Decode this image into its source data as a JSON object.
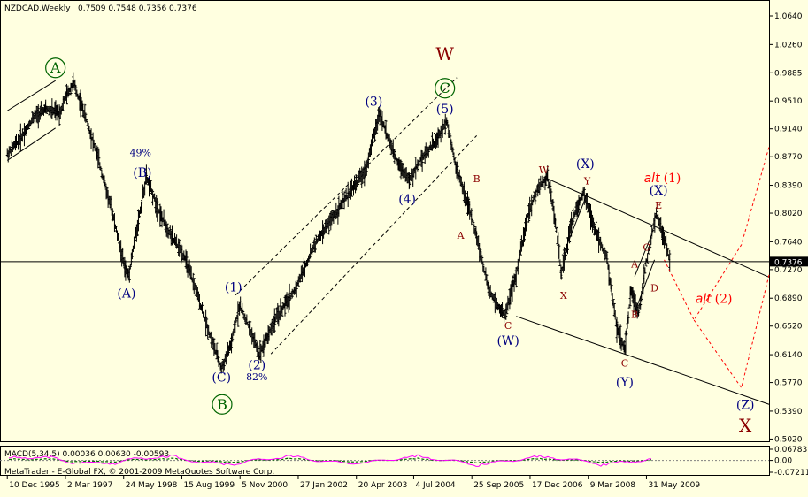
{
  "chart_data": {
    "type": "ohlc",
    "header": {
      "symbol_period": "NZDCAD,Weekly",
      "ohlc": "0.7509 0.7548 0.7356 0.7376"
    },
    "price_axis": {
      "min": 0.5025,
      "max": 1.064,
      "ticks": [
        "1.0640",
        "1.0260",
        "0.9885",
        "0.9510",
        "0.9140",
        "0.8770",
        "0.8390",
        "0.8020",
        "0.7640",
        "0.7270",
        "0.6890",
        "0.6520",
        "0.6140",
        "0.5770",
        "0.5390",
        "0.5020"
      ],
      "current_price": "0.7376",
      "current_value": 0.7376
    },
    "time_axis": {
      "ticks": [
        "10 Dec 1995",
        "2 Mar 1997",
        "24 May 1998",
        "15 Aug 1999",
        "5 Nov 2000",
        "27 Jan 2002",
        "20 Apr 2003",
        "4 Jul 2004",
        "25 Sep 2005",
        "17 Dec 2006",
        "9 Mar 2008",
        "31 May 2009"
      ]
    },
    "price_path": [
      {
        "date": "1995-12-10",
        "price": 0.88
      },
      {
        "date": "1996-03-15",
        "price": 0.9
      },
      {
        "date": "1996-07-01",
        "price": 0.93
      },
      {
        "date": "1996-10-01",
        "price": 0.94
      },
      {
        "date": "1997-01-15",
        "price": 0.935
      },
      {
        "date": "1997-03-15",
        "price": 0.96
      },
      {
        "date": "1997-05-01",
        "price": 0.975
      },
      {
        "date": "1997-07-15",
        "price": 0.94
      },
      {
        "date": "1997-11-01",
        "price": 0.88
      },
      {
        "date": "1998-03-01",
        "price": 0.8
      },
      {
        "date": "1998-06-01",
        "price": 0.73
      },
      {
        "date": "1998-07-01",
        "price": 0.72
      },
      {
        "date": "1998-09-01",
        "price": 0.78
      },
      {
        "date": "1998-11-15",
        "price": 0.85
      },
      {
        "date": "1999-03-01",
        "price": 0.8
      },
      {
        "date": "1999-06-01",
        "price": 0.77
      },
      {
        "date": "1999-09-01",
        "price": 0.745
      },
      {
        "date": "1999-12-01",
        "price": 0.7
      },
      {
        "date": "2000-03-01",
        "price": 0.65
      },
      {
        "date": "2000-06-15",
        "price": 0.595
      },
      {
        "date": "2000-09-01",
        "price": 0.63
      },
      {
        "date": "2000-11-01",
        "price": 0.68
      },
      {
        "date": "2001-01-15",
        "price": 0.65
      },
      {
        "date": "2001-04-01",
        "price": 0.615
      },
      {
        "date": "2001-08-01",
        "price": 0.66
      },
      {
        "date": "2002-01-01",
        "price": 0.7
      },
      {
        "date": "2002-06-01",
        "price": 0.76
      },
      {
        "date": "2002-11-01",
        "price": 0.8
      },
      {
        "date": "2003-03-01",
        "price": 0.83
      },
      {
        "date": "2003-07-01",
        "price": 0.86
      },
      {
        "date": "2003-10-15",
        "price": 0.935
      },
      {
        "date": "2004-02-01",
        "price": 0.88
      },
      {
        "date": "2004-06-01",
        "price": 0.845
      },
      {
        "date": "2004-09-01",
        "price": 0.875
      },
      {
        "date": "2005-01-01",
        "price": 0.9
      },
      {
        "date": "2005-03-15",
        "price": 0.925
      },
      {
        "date": "2005-06-01",
        "price": 0.86
      },
      {
        "date": "2005-09-01",
        "price": 0.81
      },
      {
        "date": "2005-11-01",
        "price": 0.77
      },
      {
        "date": "2006-02-01",
        "price": 0.7
      },
      {
        "date": "2006-06-01",
        "price": 0.665
      },
      {
        "date": "2006-09-01",
        "price": 0.72
      },
      {
        "date": "2006-12-01",
        "price": 0.8
      },
      {
        "date": "2007-02-15",
        "price": 0.835
      },
      {
        "date": "2007-05-01",
        "price": 0.85
      },
      {
        "date": "2007-07-01",
        "price": 0.79
      },
      {
        "date": "2007-08-15",
        "price": 0.72
      },
      {
        "date": "2007-11-01",
        "price": 0.79
      },
      {
        "date": "2008-02-01",
        "price": 0.83
      },
      {
        "date": "2008-05-01",
        "price": 0.78
      },
      {
        "date": "2008-08-01",
        "price": 0.74
      },
      {
        "date": "2008-10-15",
        "price": 0.65
      },
      {
        "date": "2008-12-15",
        "price": 0.62
      },
      {
        "date": "2009-02-01",
        "price": 0.7
      },
      {
        "date": "2009-04-01",
        "price": 0.67
      },
      {
        "date": "2009-06-01",
        "price": 0.74
      },
      {
        "date": "2009-08-15",
        "price": 0.8
      },
      {
        "date": "2009-10-01",
        "price": 0.775
      },
      {
        "date": "2009-12-01",
        "price": 0.738
      }
    ],
    "wave_labels": [
      {
        "text": "A",
        "style": "green-circle",
        "date": "1996-12-15",
        "price": 0.995
      },
      {
        "text": "49%",
        "style": "navy-small",
        "date": "1998-10-01",
        "price": 0.878
      },
      {
        "text": "(B)",
        "style": "navy",
        "date": "1998-10-15",
        "price": 0.85
      },
      {
        "text": "(A)",
        "style": "navy",
        "date": "1998-06-15",
        "price": 0.69
      },
      {
        "text": "(C)",
        "style": "navy",
        "date": "2000-06-15",
        "price": 0.578
      },
      {
        "text": "B",
        "style": "green-circle",
        "date": "2000-06-20",
        "price": 0.548
      },
      {
        "text": "(1)",
        "style": "navy",
        "date": "2000-09-15",
        "price": 0.698
      },
      {
        "text": "(2)",
        "style": "navy",
        "date": "2001-03-15",
        "price": 0.595
      },
      {
        "text": "82%",
        "style": "navy-small",
        "date": "2001-03-15",
        "price": 0.58
      },
      {
        "text": "(3)",
        "style": "navy",
        "date": "2003-09-01",
        "price": 0.945
      },
      {
        "text": "(4)",
        "style": "navy",
        "date": "2004-05-15",
        "price": 0.815
      },
      {
        "text": "(5)",
        "style": "navy",
        "date": "2005-03-01",
        "price": 0.935
      },
      {
        "text": "C",
        "style": "green-circle",
        "date": "2005-03-01",
        "price": 0.968
      },
      {
        "text": "W",
        "style": "red-large",
        "date": "2005-03-01",
        "price": 1.005
      },
      {
        "text": "B",
        "style": "red",
        "date": "2005-11-01",
        "price": 0.843
      },
      {
        "text": "A",
        "style": "red",
        "date": "2005-07-01",
        "price": 0.768
      },
      {
        "text": "C",
        "style": "red",
        "date": "2006-07-01",
        "price": 0.648
      },
      {
        "text": "(W)",
        "style": "navy",
        "date": "2006-07-01",
        "price": 0.627
      },
      {
        "text": "W",
        "style": "red",
        "date": "2007-04-01",
        "price": 0.855
      },
      {
        "text": "X",
        "style": "red",
        "date": "2007-09-01",
        "price": 0.688
      },
      {
        "text": "(X)",
        "style": "navy",
        "date": "2008-02-15",
        "price": 0.862
      },
      {
        "text": "Y",
        "style": "red",
        "date": "2008-03-01",
        "price": 0.84
      },
      {
        "text": "C",
        "style": "red",
        "date": "2008-12-15",
        "price": 0.598
      },
      {
        "text": "(Y)",
        "style": "navy",
        "date": "2008-12-15",
        "price": 0.572
      },
      {
        "text": "B",
        "style": "red",
        "date": "2009-03-01",
        "price": 0.663
      },
      {
        "text": "A",
        "style": "red",
        "date": "2009-03-01",
        "price": 0.73
      },
      {
        "text": "C",
        "style": "red",
        "date": "2009-06-01",
        "price": 0.752
      },
      {
        "text": "D",
        "style": "red",
        "date": "2009-08-01",
        "price": 0.698
      },
      {
        "text": "E",
        "style": "red",
        "date": "2009-09-01",
        "price": 0.808
      },
      {
        "text": "(X)",
        "style": "navy",
        "date": "2009-09-01",
        "price": 0.827
      },
      {
        "text": "(2)",
        "style": "red-alt",
        "alt": "alt",
        "date": "2010-11-01",
        "price": 0.683
      },
      {
        "text": "(Z)",
        "style": "navy",
        "date": "2011-07-01",
        "price": 0.542
      },
      {
        "text": "X",
        "style": "red-large",
        "date": "2011-07-01",
        "price": 0.512
      }
    ],
    "alt_one_label": {
      "alt": "alt",
      "text": "(1)",
      "date": "2009-08-15",
      "price": 0.843
    },
    "channels": [
      {
        "style": "solid",
        "points": [
          {
            "date": "1995-12-10",
            "price": 0.938
          },
          {
            "date": "1996-12-15",
            "price": 0.978
          }
        ]
      },
      {
        "style": "solid",
        "points": [
          {
            "date": "1995-12-10",
            "price": 0.872
          },
          {
            "date": "1996-12-15",
            "price": 0.915
          }
        ]
      },
      {
        "style": "dashed",
        "points": [
          {
            "date": "2000-10-01",
            "price": 0.693
          },
          {
            "date": "2005-06-01",
            "price": 0.982
          }
        ]
      },
      {
        "style": "dashed",
        "points": [
          {
            "date": "2001-07-01",
            "price": 0.615
          },
          {
            "date": "2005-11-01",
            "price": 0.905
          }
        ]
      },
      {
        "style": "solid",
        "points": [
          {
            "date": "2007-04-01",
            "price": 0.85
          },
          {
            "date": "2011-12-31",
            "price": 0.717
          }
        ]
      },
      {
        "style": "solid",
        "points": [
          {
            "date": "2006-09-01",
            "price": 0.665
          },
          {
            "date": "2011-12-31",
            "price": 0.548
          }
        ]
      },
      {
        "style": "solid",
        "points": [
          {
            "date": "2007-09-01",
            "price": 0.748
          },
          {
            "date": "2008-03-01",
            "price": 0.828
          }
        ]
      },
      {
        "style": "solid",
        "points": [
          {
            "date": "2009-03-01",
            "price": 0.67
          },
          {
            "date": "2009-08-01",
            "price": 0.74
          }
        ]
      },
      {
        "style": "solid",
        "points": [
          {
            "date": "2009-03-01",
            "price": 0.718
          },
          {
            "date": "2009-07-15",
            "price": 0.775
          }
        ]
      }
    ],
    "projections": [
      {
        "style": "red-dashed",
        "points": [
          {
            "date": "2009-10-15",
            "price": 0.74
          },
          {
            "date": "2010-06-01",
            "price": 0.66
          },
          {
            "date": "2011-06-01",
            "price": 0.76
          },
          {
            "date": "2011-12-31",
            "price": 0.89
          }
        ]
      },
      {
        "style": "red-dashed",
        "points": [
          {
            "date": "2010-06-01",
            "price": 0.66
          },
          {
            "date": "2011-06-01",
            "price": 0.57
          },
          {
            "date": "2011-12-31",
            "price": 0.72
          }
        ]
      }
    ],
    "indicator": {
      "label": "MACD(5,34,5) 0.00036 0.00630 -0.00593",
      "ticks": [
        "0.06783",
        "0.00",
        "-0.07211"
      ],
      "min": -0.07211,
      "max": 0.06783
    },
    "footer": "MetaTrader - E-Global FX, © 2001-2009 MetaQuotes Software Corp.",
    "colors": {
      "background": "#ffffe0",
      "bars": "#000000",
      "wave_navy": "#000080",
      "wave_red": "#8b0000",
      "wave_green": "#006400",
      "alt": "#ff0000",
      "macd_signal": "#ff00ff",
      "macd_histogram": "#006400",
      "macd_line": "#00a000"
    }
  }
}
